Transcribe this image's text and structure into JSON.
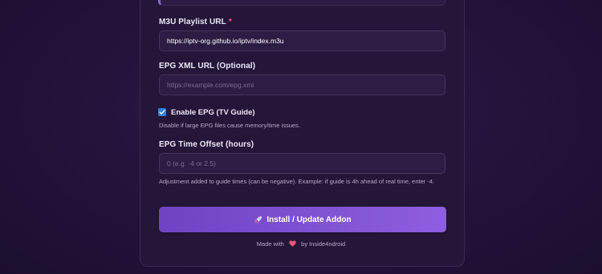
{
  "form": {
    "m3u": {
      "label": "M3U Playlist URL",
      "required_mark": "*",
      "value": "https://iptv-org.github.io/iptv/index.m3u"
    },
    "epg_url": {
      "label": "EPG XML URL (Optional)",
      "placeholder": "https://example.com/epg.xml"
    },
    "enable_epg": {
      "label": "Enable EPG (TV Guide)",
      "checked": true,
      "hint": "Disable if large EPG files cause memory/time issues."
    },
    "epg_offset": {
      "label": "EPG Time Offset (hours)",
      "placeholder": "0 (e.g. -4 or 2.5)",
      "hint": "Adjustment added to guide times (can be negative). Example: if guide is 4h ahead of real time, enter -4."
    },
    "submit_label": "Install / Update Addon",
    "submit_icon": "rocket-icon"
  },
  "footer": {
    "prefix": "Made with",
    "icon": "heart-icon",
    "suffix": "by Inside4ndroid"
  },
  "colors": {
    "accent": "#7b4fd6",
    "checkbox": "#2f7fe0",
    "required": "#ff5b7a"
  }
}
